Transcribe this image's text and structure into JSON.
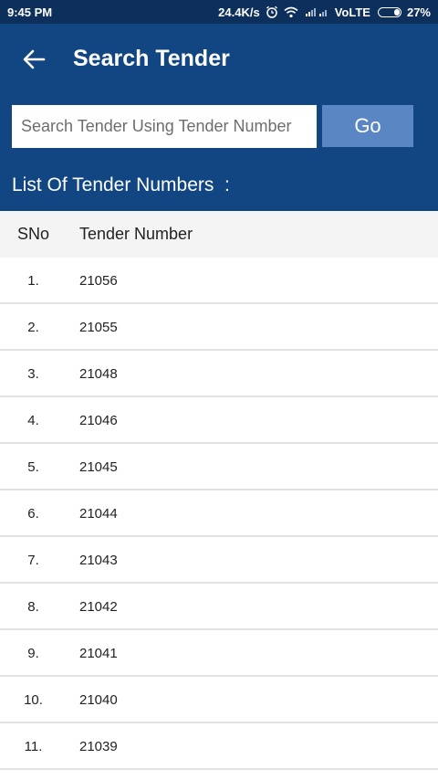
{
  "status_bar": {
    "time": "9:45 PM",
    "speed": "24.4K/s",
    "network": "VoLTE",
    "battery": "27%"
  },
  "app_bar": {
    "title": "Search Tender"
  },
  "search": {
    "placeholder": "Search Tender Using Tender Number",
    "value": "",
    "go_label": "Go"
  },
  "list_heading": "List Of Tender Numbers  :",
  "table": {
    "headers": {
      "sno": "SNo",
      "tender_number": "Tender Number"
    },
    "rows": [
      {
        "sno": "1.",
        "tender_number": "21056"
      },
      {
        "sno": "2.",
        "tender_number": "21055"
      },
      {
        "sno": "3.",
        "tender_number": "21048"
      },
      {
        "sno": "4.",
        "tender_number": "21046"
      },
      {
        "sno": "5.",
        "tender_number": "21045"
      },
      {
        "sno": "6.",
        "tender_number": "21044"
      },
      {
        "sno": "7.",
        "tender_number": "21043"
      },
      {
        "sno": "8.",
        "tender_number": "21042"
      },
      {
        "sno": "9.",
        "tender_number": "21041"
      },
      {
        "sno": "10.",
        "tender_number": "21040"
      },
      {
        "sno": "11.",
        "tender_number": "21039"
      }
    ]
  },
  "colors": {
    "status_bar": "#0d2f5c",
    "app_bar": "#124683",
    "go_button": "#5a87c4",
    "header_bg": "#f4f4f4",
    "divider": "#e2e2e2"
  },
  "icons": {
    "back": "arrow-left",
    "alarm": "alarm-clock",
    "wifi": "wifi",
    "signal": "cell-signal",
    "battery": "battery"
  }
}
